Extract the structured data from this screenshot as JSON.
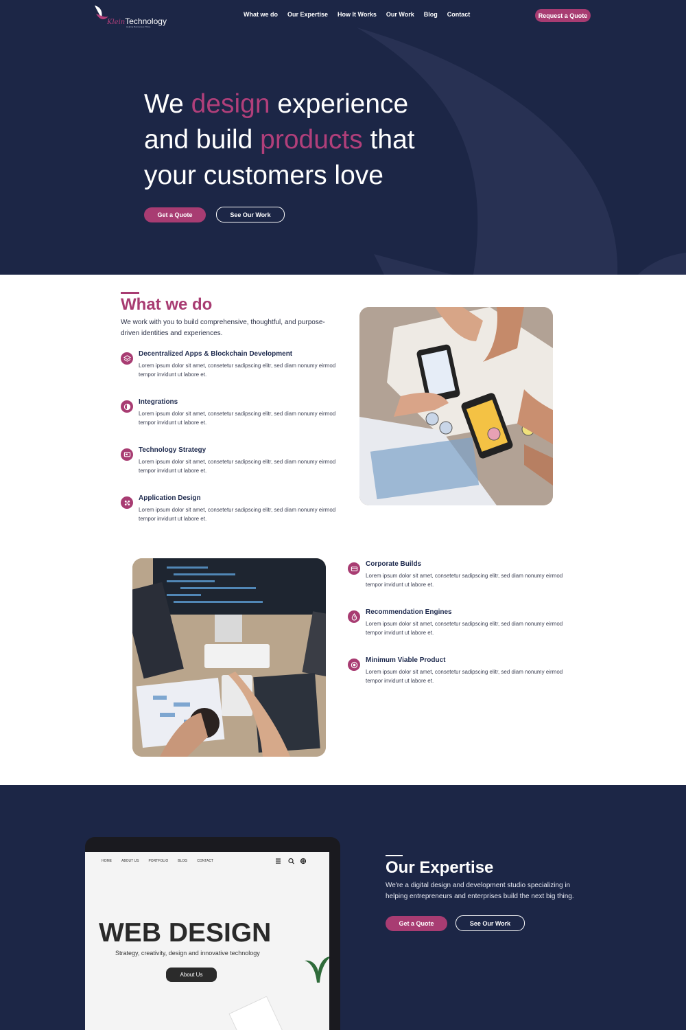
{
  "colors": {
    "navy": "#1c2646",
    "accent": "#a83c72",
    "white": "#ffffff"
  },
  "nav": {
    "logo_script": "Klein",
    "logo_word": "Technology",
    "logo_tagline": "Helping Businesses Thrive",
    "links": [
      "What we do",
      "Our Expertise",
      "How It Works",
      "Our Work",
      "Blog",
      "Contact"
    ],
    "cta": "Request a Quote"
  },
  "hero": {
    "title_part1": "We ",
    "title_accent1": "design",
    "title_part2": " experience and build ",
    "title_accent2": "products",
    "title_part3": " that your customers love",
    "primary_button": "Get a Quote",
    "secondary_button": "See Our Work"
  },
  "what_we_do": {
    "heading": "What we do",
    "intro": "We work with you to build comprehensive, thoughtful, and purpose-driven identities and experiences.",
    "services": [
      {
        "title": "Decentralized Apps & Blockchain Development",
        "desc": "Lorem ipsum dolor sit amet, consetetur sadipscing elitr, sed diam nonumy eirmod tempor invidunt ut labore et.",
        "icon": "layers-icon"
      },
      {
        "title": "Integrations",
        "desc": "Lorem ipsum dolor sit amet, consetetur sadipscing elitr, sed diam nonumy eirmod tempor invidunt ut labore et.",
        "icon": "integrations-icon"
      },
      {
        "title": "Technology Strategy",
        "desc": "Lorem ipsum dolor sit amet, consetetur sadipscing elitr, sed diam nonumy eirmod tempor invidunt ut labore et.",
        "icon": "monitor-icon"
      },
      {
        "title": "Application Design",
        "desc": "Lorem ipsum dolor sit amet, consetetur sadipscing elitr, sed diam nonumy eirmod tempor invidunt ut labore et.",
        "icon": "pattern-icon"
      },
      {
        "title": "Corporate Builds",
        "desc": "Lorem ipsum dolor sit amet, consetetur sadipscing elitr, sed diam nonumy eirmod tempor invidunt ut labore et.",
        "icon": "building-icon"
      },
      {
        "title": "Recommendation Engines",
        "desc": "Lorem ipsum dolor sit amet, consetetur sadipscing elitr, sed diam nonumy eirmod tempor invidunt ut labore et.",
        "icon": "drop-icon"
      },
      {
        "title": "Minimum Viable Product",
        "desc": "Lorem ipsum dolor sit amet, consetetur sadipscing elitr, sed diam nonumy eirmod tempor invidunt ut labore et.",
        "icon": "target-icon"
      }
    ]
  },
  "expertise": {
    "heading": "Our Expertise",
    "intro": "We're a digital design and development studio specializing in helping entrepreneurs and enterprises build the next big thing.",
    "primary_button": "Get a Quote",
    "secondary_button": "See Our Work",
    "mockup": {
      "nav": [
        "HOME",
        "ABOUT US",
        "PORTFOLIO",
        "BLOG",
        "CONTACT"
      ],
      "title": "WEB DESIGN",
      "subtitle": "Strategy, creativity, design and innovative technology",
      "button": "About Us"
    }
  }
}
